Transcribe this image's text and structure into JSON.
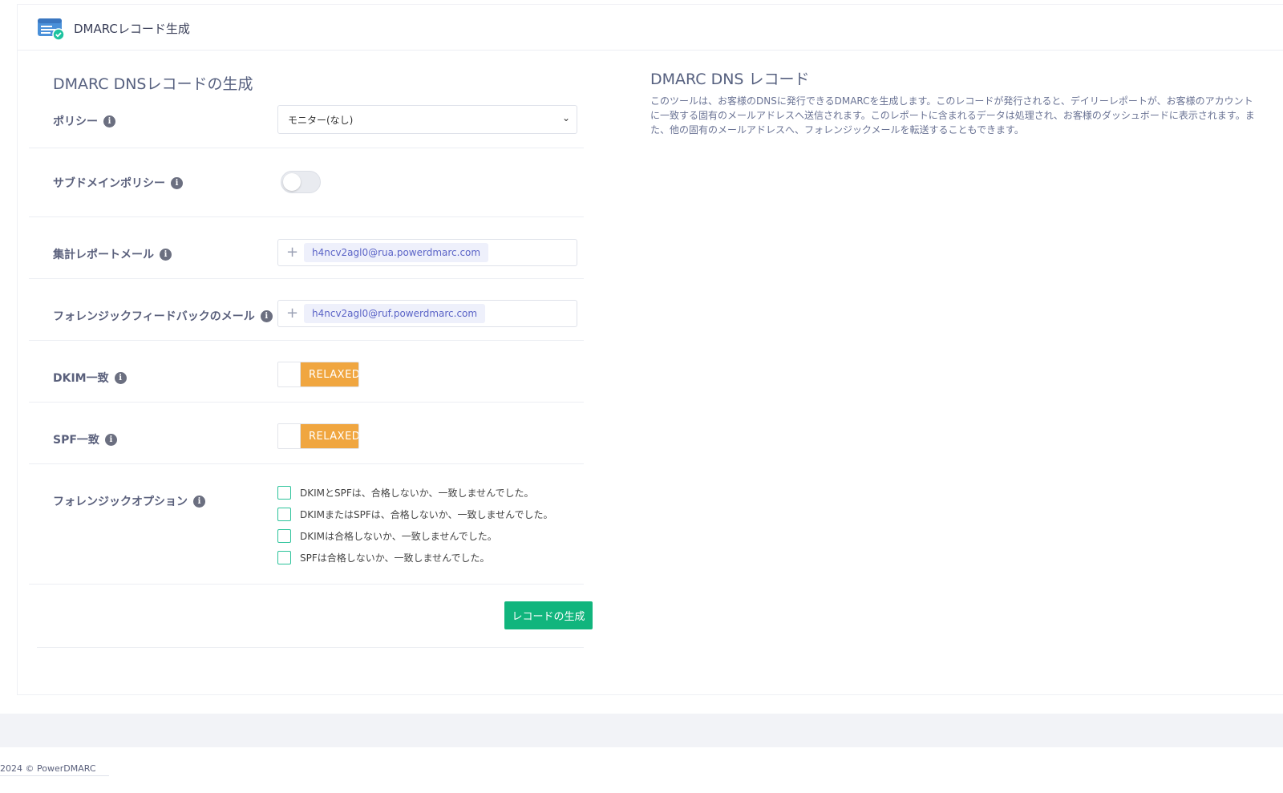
{
  "header": {
    "title": "DMARCレコード生成"
  },
  "form": {
    "section_title": "DMARC DNSレコードの生成",
    "policy": {
      "label": "ポリシー",
      "value": "モニター(なし)"
    },
    "subdomain_policy": {
      "label": "サブドメインポリシー",
      "enabled": false
    },
    "aggregate_email": {
      "label": "集計レポートメール",
      "tag": "h4ncv2agl0@rua.powerdmarc.com"
    },
    "forensic_email": {
      "label": "フォレンジックフィードバックのメール",
      "tag": "h4ncv2agl0@ruf.powerdmarc.com"
    },
    "dkim_alignment": {
      "label": "DKIM一致",
      "value": "RELAXED"
    },
    "spf_alignment": {
      "label": "SPF一致",
      "value": "RELAXED"
    },
    "forensic_options": {
      "label": "フォレンジックオプション",
      "options": [
        "DKIMとSPFは、合格しないか、一致しませんでした。",
        "DKIMまたはSPFは、合格しないか、一致しませんでした。",
        "DKIMは合格しないか、一致しませんでした。",
        "SPFは合格しないか、一致しませんでした。"
      ]
    },
    "generate_label": "レコードの生成"
  },
  "record_panel": {
    "title": "DMARC DNS レコード",
    "description": "このツールは、お客様のDNSに発行できるDMARCを生成します。このレコードが発行されると、デイリーレポートが、お客様のアカウントに一致する固有のメールアドレスへ送信されます。このレポートに含まれるデータは処理され、お客様のダッシュボードに表示されます。また、他の固有のメールアドレスへ、フォレンジックメールを転送することもできます。"
  },
  "footer": {
    "text": "2024 © PowerDMARC"
  },
  "icons": {
    "info": "info-icon",
    "plus": "plus-icon",
    "chevron": "chevron-down-icon",
    "logo": "dmarc-logo-icon"
  },
  "colors": {
    "accent_green": "#11b57d",
    "relaxed_orange": "#f0a640",
    "checkbox_border": "#2bc39a"
  }
}
